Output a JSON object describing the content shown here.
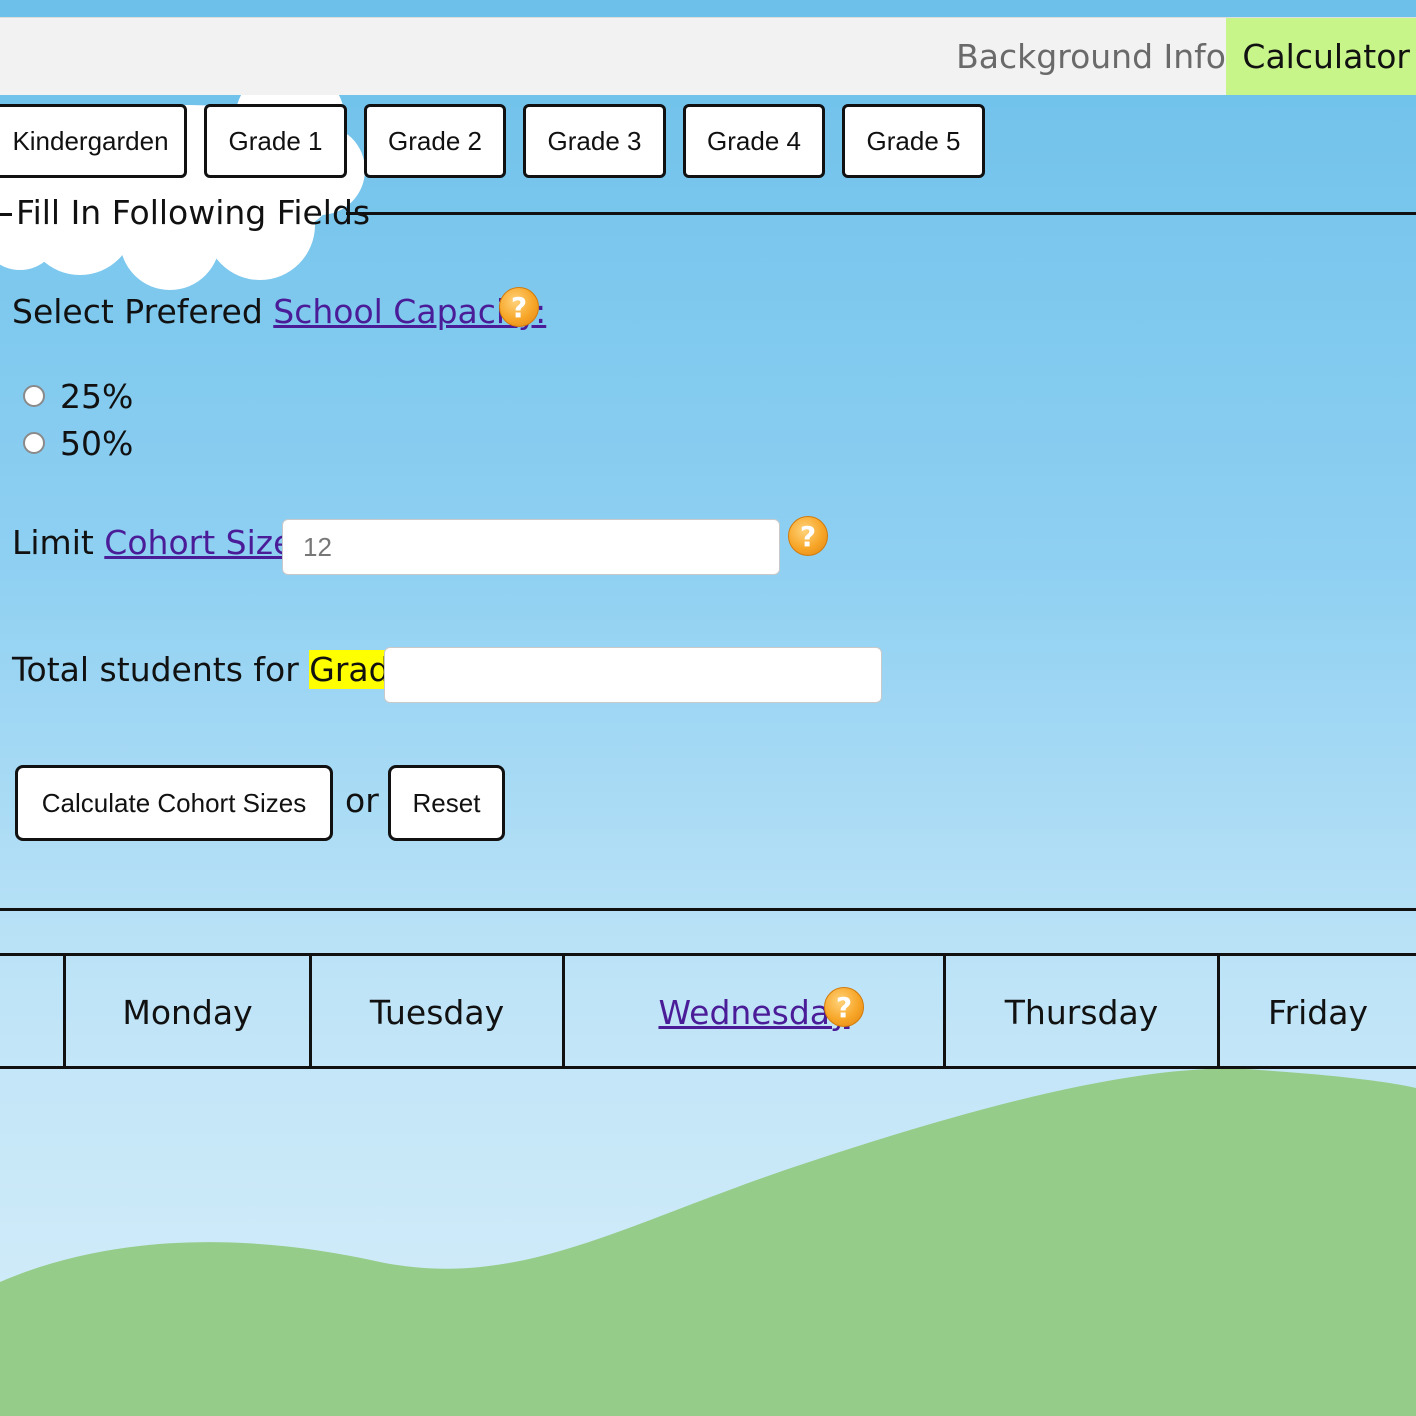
{
  "nav": {
    "background_info": "Background Info",
    "calculator": "Calculator"
  },
  "grades": [
    "Kindergarden",
    "Grade 1",
    "Grade 2",
    "Grade 3",
    "Grade 4",
    "Grade 5"
  ],
  "form": {
    "legend": "Fill In Following Fields",
    "capacity_prefix": "Select Prefered ",
    "capacity_link": "School Capacity:",
    "capacity_options": [
      "25%",
      "50%"
    ],
    "cohort_prefix": "Limit ",
    "cohort_link": "Cohort Size:",
    "cohort_placeholder": "12",
    "total_prefix": "Total students for ",
    "total_highlight": "Grade:",
    "total_value": "",
    "calculate_label": "Calculate Cohort Sizes",
    "or_text": "or",
    "reset_label": "Reset"
  },
  "schedule": {
    "days": [
      "Monday",
      "Tuesday",
      "Wednesday",
      "Thursday",
      "Friday"
    ]
  },
  "icons": {
    "help": "question-mark-icon",
    "help_glyph": "?"
  },
  "colors": {
    "active_tab": "#c8f58a",
    "link": "#4b1c98",
    "highlight": "#ffff00",
    "help_icon": "#f7a628",
    "hill": "#96cc89"
  }
}
